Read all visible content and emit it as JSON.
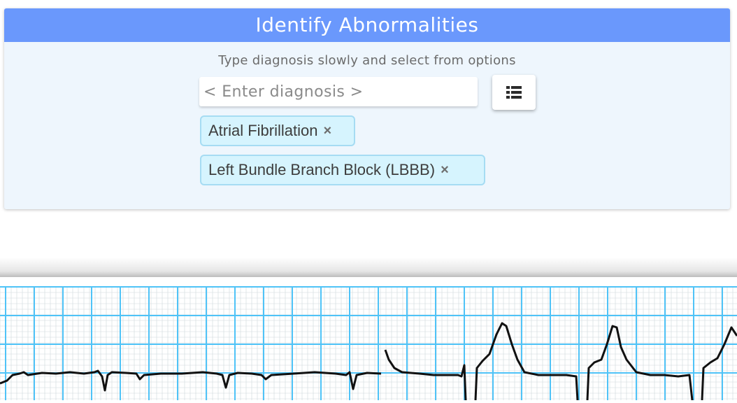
{
  "panel": {
    "title": "Identify Abnormalities",
    "instruction": "Type diagnosis slowly and select from options",
    "input": {
      "placeholder": "< Enter diagnosis >",
      "value": ""
    },
    "list_button_icon": "list-icon"
  },
  "selected_diagnoses": [
    {
      "label": "Atrial Fibrillation",
      "remove_icon": "×"
    },
    {
      "label": "Left Bundle Branch Block (LBBB)",
      "remove_icon": "×"
    }
  ],
  "ecg": {
    "grid_color": "#4fc3f7",
    "trace_color": "#111111"
  },
  "colors": {
    "header": "#6a98fc",
    "panel_bg": "#eef6fd",
    "tag_bg": "#d6f4fe",
    "tag_border": "#a6dcf3"
  }
}
